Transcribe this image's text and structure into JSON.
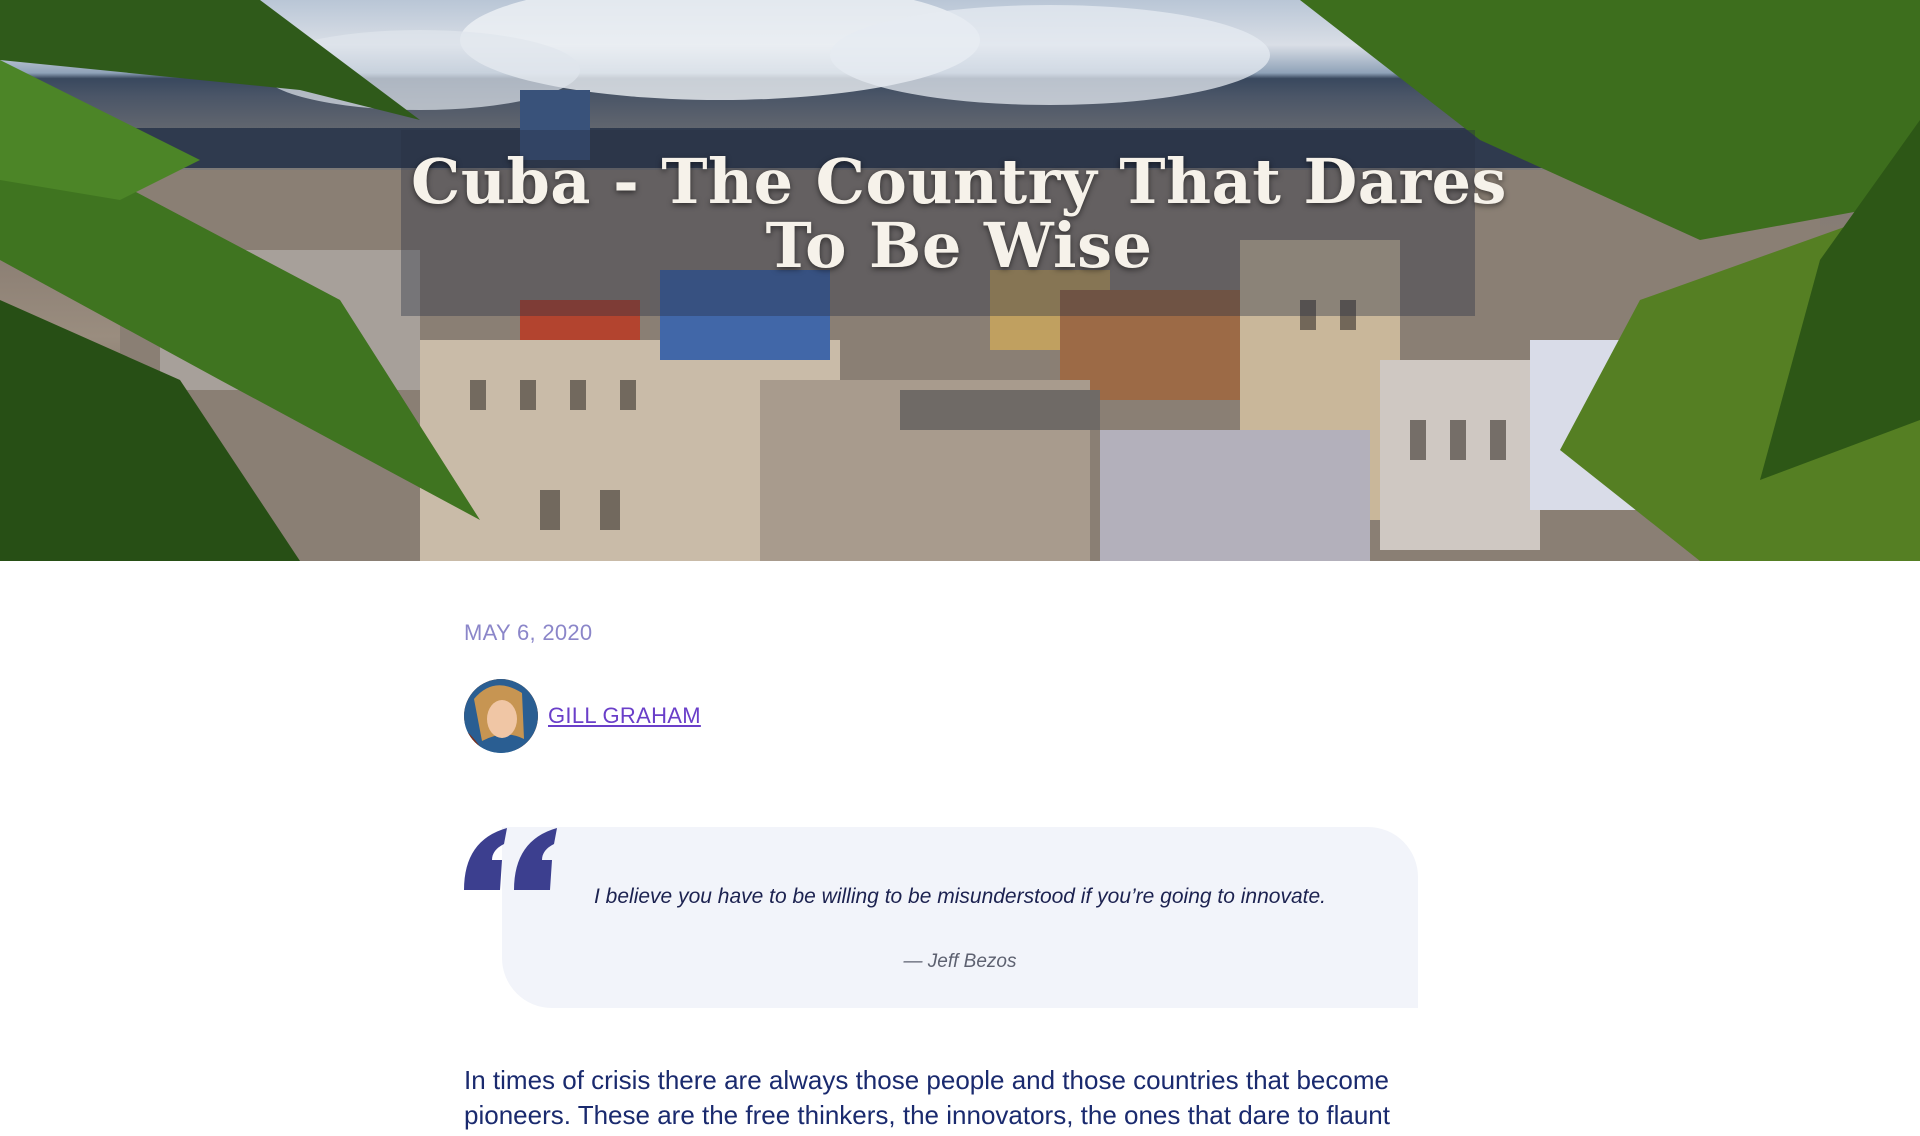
{
  "hero": {
    "title": "Cuba - The Country That Dares To Be Wise"
  },
  "post": {
    "date": "MAY 6, 2020",
    "author_name": "GILL GRAHAM"
  },
  "quote": {
    "text": "I believe you have to be willing to be misunderstood if you’re going to innovate.",
    "author": "—  Jeff Bezos"
  },
  "body": {
    "paragraph": "In times of crisis there are always those people and those countries that become pioneers. These are the free thinkers, the innovators, the ones that dare to flaunt"
  },
  "colors": {
    "accent": "#6a3fc9",
    "date": "#8b86c9",
    "quote_mark": "#3c3f8f",
    "body_text": "#1a2a6e",
    "quote_bg": "#f2f4fa"
  }
}
